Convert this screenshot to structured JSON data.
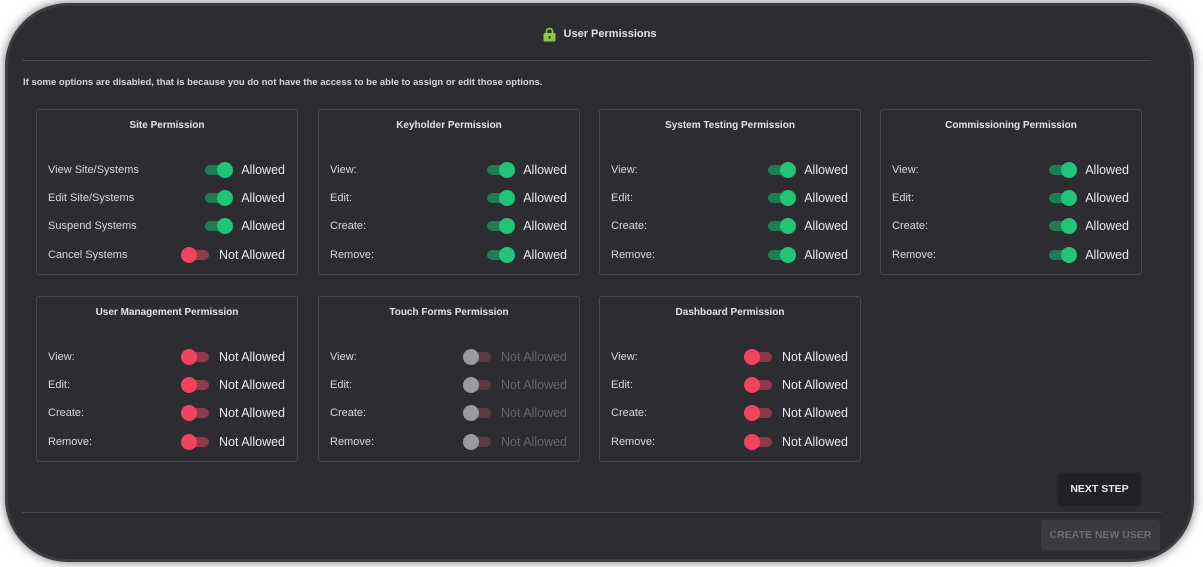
{
  "header": {
    "title": "User Permissions",
    "icon": "lock-icon",
    "icon_color": "#8dc63f"
  },
  "notice": "If some options are disabled, that is because you do not have the access to be able to assign or edit those options.",
  "cards": [
    {
      "title": "Site Permission",
      "rows": [
        {
          "label": "View Site/Systems",
          "value": "Allowed",
          "state": "on"
        },
        {
          "label": "Edit Site/Systems",
          "value": "Allowed",
          "state": "on"
        },
        {
          "label": "Suspend Systems",
          "value": "Allowed",
          "state": "on"
        },
        {
          "label": "Cancel Systems",
          "value": "Not Allowed",
          "state": "off"
        }
      ]
    },
    {
      "title": "Keyholder Permission",
      "rows": [
        {
          "label": "View:",
          "value": "Allowed",
          "state": "on"
        },
        {
          "label": "Edit:",
          "value": "Allowed",
          "state": "on"
        },
        {
          "label": "Create:",
          "value": "Allowed",
          "state": "on"
        },
        {
          "label": "Remove:",
          "value": "Allowed",
          "state": "on"
        }
      ]
    },
    {
      "title": "System Testing Permission",
      "rows": [
        {
          "label": "View:",
          "value": "Allowed",
          "state": "on"
        },
        {
          "label": "Edit:",
          "value": "Allowed",
          "state": "on"
        },
        {
          "label": "Create:",
          "value": "Allowed",
          "state": "on"
        },
        {
          "label": "Remove:",
          "value": "Allowed",
          "state": "on"
        }
      ]
    },
    {
      "title": "Commissioning Permission",
      "rows": [
        {
          "label": "View:",
          "value": "Allowed",
          "state": "on"
        },
        {
          "label": "Edit:",
          "value": "Allowed",
          "state": "on"
        },
        {
          "label": "Create:",
          "value": "Allowed",
          "state": "on"
        },
        {
          "label": "Remove:",
          "value": "Allowed",
          "state": "on"
        }
      ]
    },
    {
      "title": "User Management Permission",
      "rows": [
        {
          "label": "View:",
          "value": "Not Allowed",
          "state": "off"
        },
        {
          "label": "Edit:",
          "value": "Not Allowed",
          "state": "off"
        },
        {
          "label": "Create:",
          "value": "Not Allowed",
          "state": "off"
        },
        {
          "label": "Remove:",
          "value": "Not Allowed",
          "state": "off"
        }
      ]
    },
    {
      "title": "Touch Forms Permission",
      "rows": [
        {
          "label": "View:",
          "value": "Not Allowed",
          "state": "disabled"
        },
        {
          "label": "Edit:",
          "value": "Not Allowed",
          "state": "disabled"
        },
        {
          "label": "Create:",
          "value": "Not Allowed",
          "state": "disabled"
        },
        {
          "label": "Remove:",
          "value": "Not Allowed",
          "state": "disabled"
        }
      ]
    },
    {
      "title": "Dashboard Permission",
      "rows": [
        {
          "label": "View:",
          "value": "Not Allowed",
          "state": "off"
        },
        {
          "label": "Edit:",
          "value": "Not Allowed",
          "state": "off"
        },
        {
          "label": "Create:",
          "value": "Not Allowed",
          "state": "off"
        },
        {
          "label": "Remove:",
          "value": "Not Allowed",
          "state": "off"
        }
      ]
    }
  ],
  "buttons": {
    "next_step": "NEXT STEP",
    "create_new_user": "CREATE NEW USER"
  },
  "colors": {
    "background": "#2c2c31",
    "allowed": "#22c47a",
    "not_allowed": "#f0455d",
    "disabled": "#9a9aa0"
  }
}
